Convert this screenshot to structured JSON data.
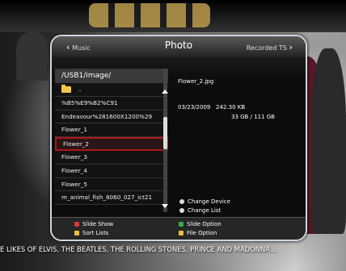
{
  "header": {
    "left_label": "Music",
    "title": "Photo",
    "right_label": "Recorded TS"
  },
  "browser": {
    "path": "/USB1/image/",
    "items": [
      {
        "label": "..",
        "icon": "folder-icon"
      },
      {
        "label": "%B5%E9%B2%C91"
      },
      {
        "label": "Endeavour%281600X1200%29"
      },
      {
        "label": "Flower_1"
      },
      {
        "label": "Flower_2",
        "selected": true
      },
      {
        "label": "Flower_3"
      },
      {
        "label": "Flower_4"
      },
      {
        "label": "Flower_5"
      },
      {
        "label": "m_animal_fish_8060_027_ict21"
      }
    ]
  },
  "info": {
    "filename": "Flower_2.jpg",
    "date": "03/23/2009",
    "size": "242.30 KB",
    "capacity": "33 GB / 111 GB"
  },
  "options": [
    {
      "label": "Change Device"
    },
    {
      "label": "Change List"
    }
  ],
  "footer": {
    "slide_show": "Slide Show",
    "sort_lists": "Sort Lists",
    "slide_option": "Slide Option",
    "file_option": "File Option"
  },
  "colors": {
    "red": "#d23a3a",
    "yellow": "#e8c23a",
    "green": "#3aa84a",
    "selection_border": "#b01616"
  },
  "ticker": "E LIKES OF ELVIS, THE BEATLES, THE ROLLING STONES, PRINCE AND MADONNA..."
}
